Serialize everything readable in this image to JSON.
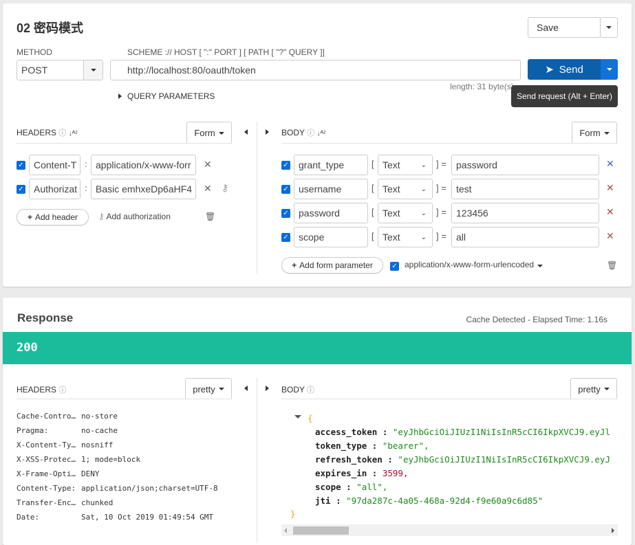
{
  "request": {
    "title": "02 密码模式",
    "save_label": "Save",
    "method_label": "METHOD",
    "method_value": "POST",
    "url_label": "SCHEME :// HOST [ \":\" PORT ] [ PATH [ \"?\" QUERY ]]",
    "url_value": "http://localhost:80/oauth/token",
    "length_text": "length: 31 byte(s)",
    "send_label": "Send",
    "send_tooltip": "Send request (Alt + Enter)",
    "query_params_label": "QUERY PARAMETERS",
    "headers": {
      "title": "HEADERS",
      "mode": "Form",
      "items": [
        {
          "name": "Content-T",
          "value": "application/x-www-forr"
        },
        {
          "name": "Authorizat",
          "value": "Basic emhxeDp6aHF4"
        }
      ],
      "add_header": "Add header",
      "add_authorization": "Add authorization"
    },
    "body": {
      "title": "BODY",
      "mode": "Form",
      "items": [
        {
          "name": "grant_type",
          "type": "Text",
          "value": "password"
        },
        {
          "name": "username",
          "type": "Text",
          "value": "test"
        },
        {
          "name": "password",
          "type": "Text",
          "value": "123456"
        },
        {
          "name": "scope",
          "type": "Text",
          "value": "all"
        }
      ],
      "add_param": "Add form parameter",
      "content_type": "application/x-www-form-urlencoded"
    }
  },
  "response": {
    "title": "Response",
    "meta": "Cache Detected - Elapsed Time: 1.16s",
    "status": "200",
    "status_color": "#1abc9c",
    "headers": {
      "title": "HEADERS",
      "mode": "pretty",
      "items": [
        {
          "k": "Cache-Contro…",
          "v": "no-store"
        },
        {
          "k": "Pragma:",
          "v": "no-cache"
        },
        {
          "k": "X-Content-Ty…",
          "v": "nosniff"
        },
        {
          "k": "X-XSS-Protec…",
          "v": "1; mode=block"
        },
        {
          "k": "X-Frame-Opti…",
          "v": "DENY"
        },
        {
          "k": "Content-Type:",
          "v": "application/json;charset=UTF-8"
        },
        {
          "k": "Transfer-Enc…",
          "v": "chunked"
        },
        {
          "k": "Date:",
          "v": "Sat, 10 Oct 2019 01:49:54 GMT"
        }
      ]
    },
    "body": {
      "title": "BODY",
      "mode": "pretty",
      "items": [
        {
          "k": "access_token",
          "v": "\"eyJhbGciOiJIUzI1NiIsInR5cCI6IkpXVCJ9.eyJl",
          "t": "str"
        },
        {
          "k": "token_type",
          "v": "\"bearer\",",
          "t": "str"
        },
        {
          "k": "refresh_token",
          "v": "\"eyJhbGciOiJIUzI1NiIsInR5cCI6IkpXVCJ9.eyJ",
          "t": "str"
        },
        {
          "k": "expires_in",
          "v": "3599,",
          "t": "num"
        },
        {
          "k": "scope",
          "v": "\"all\",",
          "t": "str"
        },
        {
          "k": "jti",
          "v": "\"97da287c-4a05-468a-92d4-f9e60a9c6d85\"",
          "t": "str"
        }
      ]
    }
  }
}
